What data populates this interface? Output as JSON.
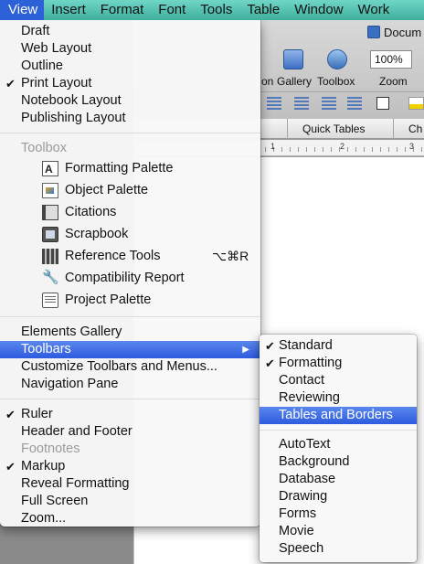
{
  "menubar": {
    "items": [
      "View",
      "Insert",
      "Format",
      "Font",
      "Tools",
      "Table",
      "Window",
      "Work"
    ],
    "active_index": 0
  },
  "background": {
    "document_title": "Docum",
    "toolbar_labels": {
      "gallery_prefix": "on",
      "gallery": "Gallery",
      "toolbox": "Toolbox",
      "zoom": "Zoom"
    },
    "zoom_value": "100%",
    "ribbon_tabs": [
      "Quick Tables",
      "Ch"
    ],
    "ruler_numbers": [
      "1",
      "2",
      "3"
    ]
  },
  "view_menu": {
    "section1": [
      {
        "label": "Draft",
        "checked": false
      },
      {
        "label": "Web Layout",
        "checked": false
      },
      {
        "label": "Outline",
        "checked": false
      },
      {
        "label": "Print Layout",
        "checked": true
      },
      {
        "label": "Notebook Layout",
        "checked": false
      },
      {
        "label": "Publishing Layout",
        "checked": false
      }
    ],
    "toolbox_header": "Toolbox",
    "toolbox_items": [
      {
        "label": "Formatting Palette",
        "icon": "formatting-palette-icon"
      },
      {
        "label": "Object Palette",
        "icon": "object-palette-icon"
      },
      {
        "label": "Citations",
        "icon": "citations-icon"
      },
      {
        "label": "Scrapbook",
        "icon": "scrapbook-icon"
      },
      {
        "label": "Reference Tools",
        "icon": "reference-tools-icon",
        "shortcut": "⌥⌘R"
      },
      {
        "label": "Compatibility Report",
        "icon": "wrench-icon"
      },
      {
        "label": "Project Palette",
        "icon": "project-palette-icon"
      }
    ],
    "section3": [
      {
        "label": "Elements Gallery"
      },
      {
        "label": "Toolbars",
        "highlighted": true,
        "submenu_arrow": "▶"
      },
      {
        "label": "Customize Toolbars and Menus..."
      },
      {
        "label": "Navigation Pane"
      }
    ],
    "section4": [
      {
        "label": "Ruler",
        "checked": true
      },
      {
        "label": "Header and Footer",
        "checked": false
      },
      {
        "label": "Footnotes",
        "disabled": true
      },
      {
        "label": "Markup",
        "checked": true
      },
      {
        "label": "Reveal Formatting",
        "checked": false
      },
      {
        "label": "Full Screen",
        "checked": false
      },
      {
        "label": "Zoom...",
        "checked": false
      }
    ],
    "check_glyph": "✔"
  },
  "toolbars_submenu": {
    "group1": [
      {
        "label": "Standard",
        "checked": true
      },
      {
        "label": "Formatting",
        "checked": true
      },
      {
        "label": "Contact",
        "checked": false
      },
      {
        "label": "Reviewing",
        "checked": false
      },
      {
        "label": "Tables and Borders",
        "checked": false,
        "highlighted": true
      }
    ],
    "group2": [
      {
        "label": "AutoText"
      },
      {
        "label": "Background"
      },
      {
        "label": "Database"
      },
      {
        "label": "Drawing"
      },
      {
        "label": "Forms"
      },
      {
        "label": "Movie"
      },
      {
        "label": "Speech"
      }
    ]
  },
  "colors": {
    "menubar_accent": "#4fc0ad",
    "highlight": "#2d5be0"
  }
}
